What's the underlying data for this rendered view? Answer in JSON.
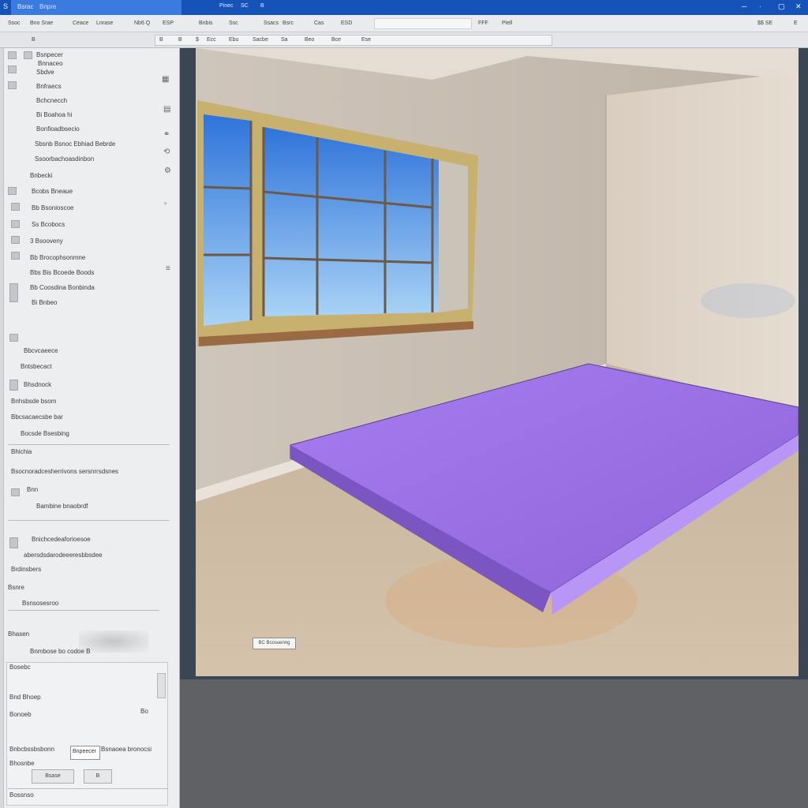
{
  "titlebar": {
    "app_icon": "S",
    "tab_1": "Bsrac",
    "tab_2": "Bnpre",
    "menu": [
      "Pinec",
      "SC",
      "B"
    ],
    "controls": [
      "─",
      "·",
      "▢",
      "✕"
    ]
  },
  "menubar": {
    "items": [
      "Ssoc",
      "Bno Srae",
      "Ceace",
      "Lnrase",
      "Nb6 Q",
      "ESP",
      "Bnbis",
      "Ssc",
      "Ssacs",
      "Bsrc",
      "Cas",
      "ESD",
      "FFF",
      "Piell",
      "$$ SE",
      "E"
    ]
  },
  "toolbar": {
    "items": [
      "B",
      "B",
      "B",
      "$",
      "Ecc",
      "Ebu",
      "Sacbe",
      "Sa",
      "Beo",
      "Bce",
      "Ese"
    ]
  },
  "left_panel": {
    "items": [
      "Bsnpecer",
      "Bnnaceo",
      "Sbdve",
      "Bnfraecs",
      "Bchcnecch",
      "Bi Boahoa hi",
      "Bonfioadbsecio",
      "Sbsnb Bsnoc Ebhiad Bebrde",
      "Ssoorbachoasdinbon",
      "Bnbecki",
      "Bcobs Bneaue",
      "Bb Bsonioscoe",
      "Ss Bcobocs",
      "3 Bsooveny",
      "Bb Brocophsonmne",
      "Bbs Bis Bcoede Boods",
      "Bb Coosdina Bonbinda",
      "Bi Bnbeo",
      "Bbcvcaeece",
      "Bntsbecact",
      "Bhsdnock",
      "Bnhsbsde bsom",
      "Bbcsacaecsbe bar",
      "Bocsde Bsesbing",
      "Bhichia",
      "Bsocnoradcesherrivons sersnrrsdsnes",
      "Bnn",
      "Bambine bnaobrdf",
      "Bnichcedeaforioesoe",
      "abersdsdarodeeeresbbsdee",
      "Brdinsbers",
      "Bsnre",
      "Bsnsosesroo",
      "Bhasen",
      "Bnmbose bo codoe B",
      "Bosebc",
      "Bnd Bhoep",
      "Bonoeb",
      "Bo",
      "Bnbcbssbsbonn",
      "Bsnaoea bronocsi",
      "Bhosnbe",
      "Bsase",
      "B",
      "Bossnso"
    ],
    "field_value": "Bnpeecer"
  },
  "viewport": {
    "view_label": "BC Bcosuenng"
  },
  "colors": {
    "titlebar": "#1553b8",
    "panel": "#eceef0",
    "viewport_frame": "#3b4654",
    "slab_purple": "#9a6ee2",
    "window_frame": "#c8b06e",
    "sky": "#4f93e6"
  }
}
